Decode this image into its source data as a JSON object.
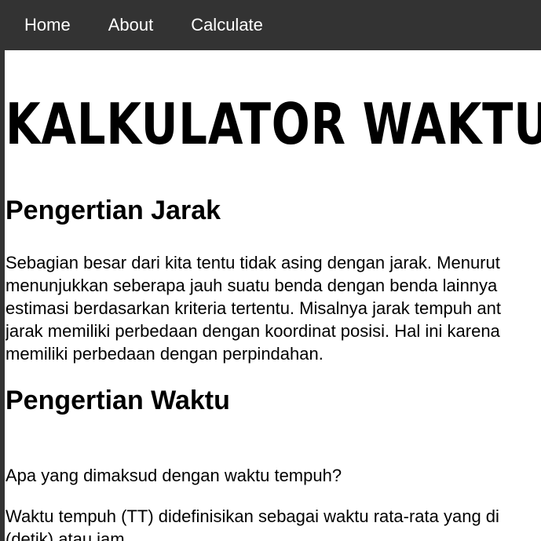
{
  "nav": {
    "items": [
      "Home",
      "About",
      "Calculate"
    ]
  },
  "page": {
    "title": "KALKULATOR WAKTU DA",
    "sections": [
      {
        "heading": "Pengertian Jarak",
        "lines": [
          "Sebagian besar dari kita tentu tidak asing dengan jarak. Menurut",
          "menunjukkan seberapa jauh suatu benda dengan benda lainnya",
          "estimasi berdasarkan kriteria tertentu. Misalnya jarak tempuh ant",
          "jarak memiliki perbedaan dengan koordinat posisi. Hal ini karena",
          "memiliki perbedaan dengan perpindahan."
        ]
      },
      {
        "heading": "Pengertian Waktu",
        "question": "Apa yang dimaksud dengan waktu tempuh?",
        "lines": [
          "Waktu tempuh (TT) didefinisikan sebagai waktu rata-rata yang di",
          "(detik) atau jam."
        ]
      }
    ]
  },
  "colors": {
    "nav_background": "#333333",
    "nav_text": "#ffffff",
    "page_background": "#ffffff",
    "text": "#000000"
  }
}
